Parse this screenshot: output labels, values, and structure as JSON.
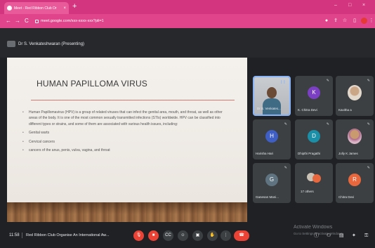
{
  "browser": {
    "tab_title": "Meet - Red Ribbon Club Or",
    "url": "meet.google.com/xxx-xxxx-xxx?pli=1",
    "new_tab": "+",
    "tab_close": "×",
    "win_min": "–",
    "win_max": "□",
    "win_close": "×",
    "back": "←",
    "forward": "→",
    "reload": "C",
    "star": "☆"
  },
  "meet": {
    "presenter_label": "Dr S. Venkateshwaran (Presenting)",
    "slide": {
      "title": "HUMAN PAPILLOMA VIRUS",
      "bullets": [
        "Human Papillomavirus (HPV) is a group of related viruses that can infect the genital area, mouth, and throat, as well as other areas of the body. It is one of the most common sexually transmitted infections (STIs) worldwide. HPV can be classified into different types or strains, and some of them are associated with various health issues, including:",
        "Genital warts",
        "Cervical cancers",
        "cancers of the anus, penis, vulva, vagina, and throat"
      ]
    },
    "participants": [
      {
        "name": "Dr S. Venkates...",
        "type": "camera"
      },
      {
        "name": "K. Chitra Devi",
        "initial": "K",
        "color": "#7b3fc4"
      },
      {
        "name": "Kavitha a",
        "type": "photo"
      },
      {
        "name": "Harisha Hari",
        "initial": "H",
        "color": "#3f5fc4"
      },
      {
        "name": "Dhipthi Pragathi",
        "initial": "D",
        "color": "#1b8fa8"
      },
      {
        "name": "Jolly K James",
        "type": "photo"
      },
      {
        "name": "Ganesan Mani...",
        "initial": "G",
        "color": "#5f7480"
      },
      {
        "name": "17 others",
        "type": "others"
      },
      {
        "name": "Chitra Devi",
        "initial": "R",
        "color": "#e8673d"
      }
    ],
    "bottom": {
      "time": "11:58",
      "meeting_title": "Red Ribbon Club Organise An International Aw...",
      "watermark": "Activate Windows",
      "watermark_sub": "Go to Settings to activate Windows.",
      "controls": [
        {
          "name": "mic-off",
          "glyph": "🎙",
          "style": "red"
        },
        {
          "name": "camera-off",
          "glyph": "■",
          "style": "red"
        },
        {
          "name": "captions",
          "glyph": "CC",
          "style": "grey"
        },
        {
          "name": "emoji",
          "glyph": "☺",
          "style": "grey"
        },
        {
          "name": "present",
          "glyph": "▣",
          "style": "grey"
        },
        {
          "name": "raise-hand",
          "glyph": "✋",
          "style": "grey"
        },
        {
          "name": "more",
          "glyph": "⋮",
          "style": "grey"
        },
        {
          "name": "leave-call",
          "glyph": "☎",
          "style": "end"
        }
      ],
      "right_icons": [
        {
          "name": "info",
          "glyph": "ⓘ"
        },
        {
          "name": "people",
          "glyph": "⚇"
        },
        {
          "name": "chat",
          "glyph": "▤"
        },
        {
          "name": "activities",
          "glyph": "✦"
        },
        {
          "name": "host-controls",
          "glyph": "⚿"
        }
      ]
    }
  }
}
